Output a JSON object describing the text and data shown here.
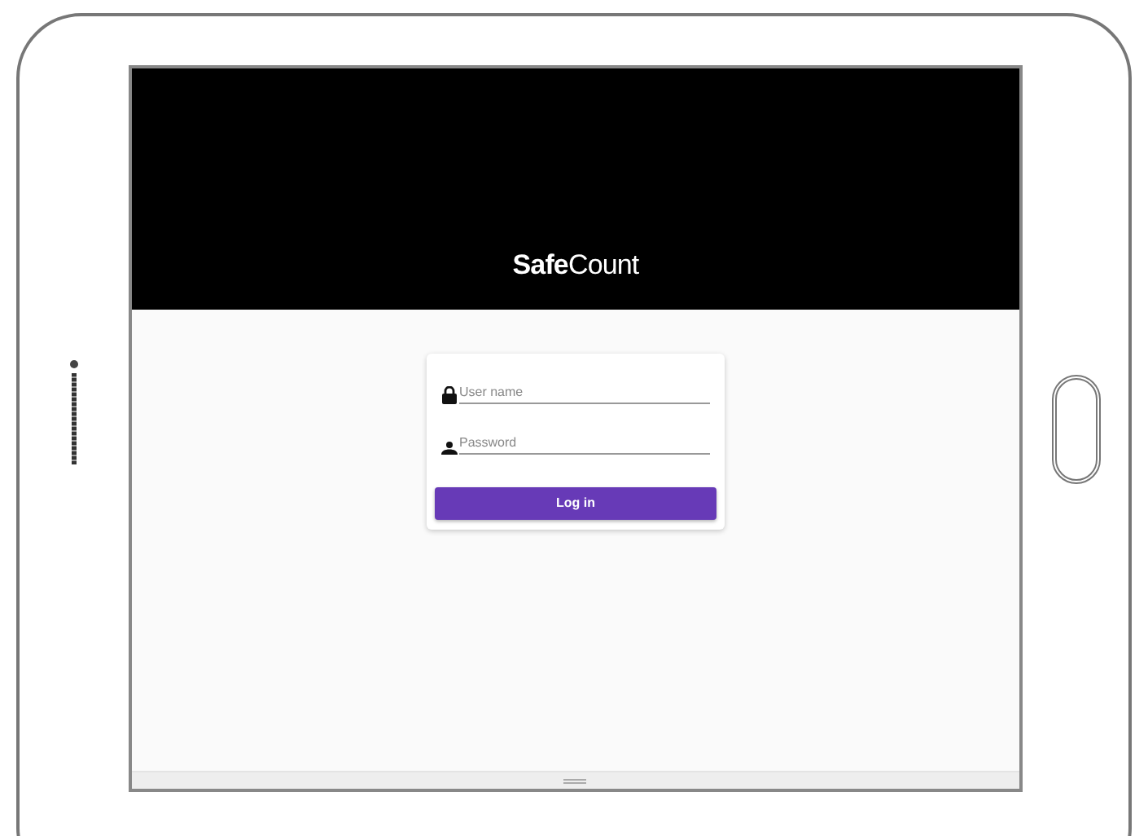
{
  "header": {
    "logo": "**Safe**Count"
  },
  "login_form": {
    "fields": [
      {
        "kind": "text",
        "placeholder": "User name"
      },
      {
        "kind": "password",
        "placeholder": "Password"
      }
    ],
    "submit_button": "Log in"
  }
}
